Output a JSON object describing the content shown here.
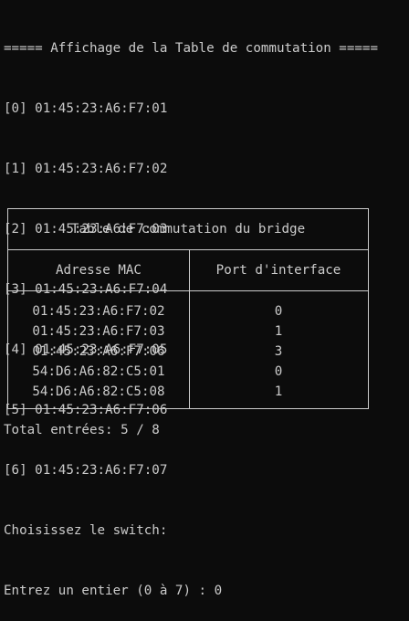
{
  "terminal": {
    "header": "===== Affichage de la Table de commutation =====",
    "switches": [
      "[0] 01:45:23:A6:F7:01",
      "[1] 01:45:23:A6:F7:02",
      "[2] 01:45:23:A6:F7:03",
      "[3] 01:45:23:A6:F7:04",
      "[4] 01:45:23:A6:F7:05",
      "[5] 01:45:23:A6:F7:06",
      "[6] 01:45:23:A6:F7:07"
    ],
    "prompt_choose": "Choisissez le switch:",
    "prompt_enter": "Entrez un entier (0 à 7) : 0"
  },
  "table": {
    "title": "Table de commutation du bridge",
    "columns": [
      "Adresse MAC",
      "Port d'interface"
    ],
    "rows": [
      {
        "mac": "01:45:23:A6:F7:02",
        "port": "0"
      },
      {
        "mac": "01:45:23:A6:F7:03",
        "port": "1"
      },
      {
        "mac": "01:45:23:A6:F7:06",
        "port": "3"
      },
      {
        "mac": "54:D6:A6:82:C5:01",
        "port": "0"
      },
      {
        "mac": "54:D6:A6:82:C5:08",
        "port": "1"
      }
    ]
  },
  "footer": {
    "total": "Total entrées: 5 / 8"
  },
  "colors": {
    "background": "#0c0c0c",
    "text": "#cccccc"
  }
}
